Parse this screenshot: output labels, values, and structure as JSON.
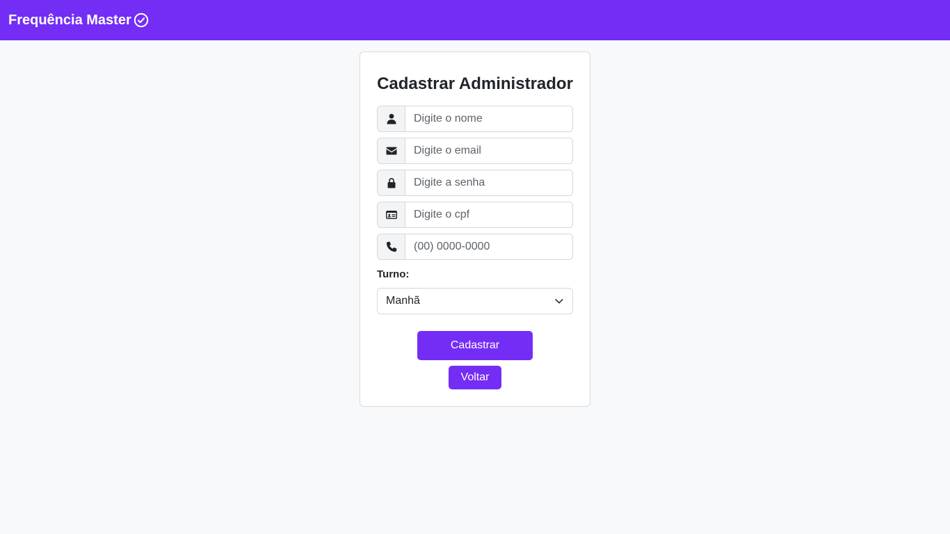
{
  "navbar": {
    "brand": "Frequência Master",
    "brand_icon": "check-circle-icon",
    "color": "#732df5"
  },
  "form": {
    "title": "Cadastrar Administrador",
    "fields": {
      "nome": {
        "placeholder": "Digite o nome",
        "icon": "user-icon"
      },
      "email": {
        "placeholder": "Digite o email",
        "icon": "envelope-icon"
      },
      "senha": {
        "placeholder": "Digite a senha",
        "icon": "lock-icon"
      },
      "cpf": {
        "placeholder": "Digite o cpf",
        "icon": "id-card-icon"
      },
      "telefone": {
        "placeholder": "(00) 0000-0000",
        "icon": "phone-icon"
      }
    },
    "turno": {
      "label": "Turno:",
      "selected": "Manhã"
    },
    "submit_label": "Cadastrar",
    "back_label": "Voltar"
  }
}
